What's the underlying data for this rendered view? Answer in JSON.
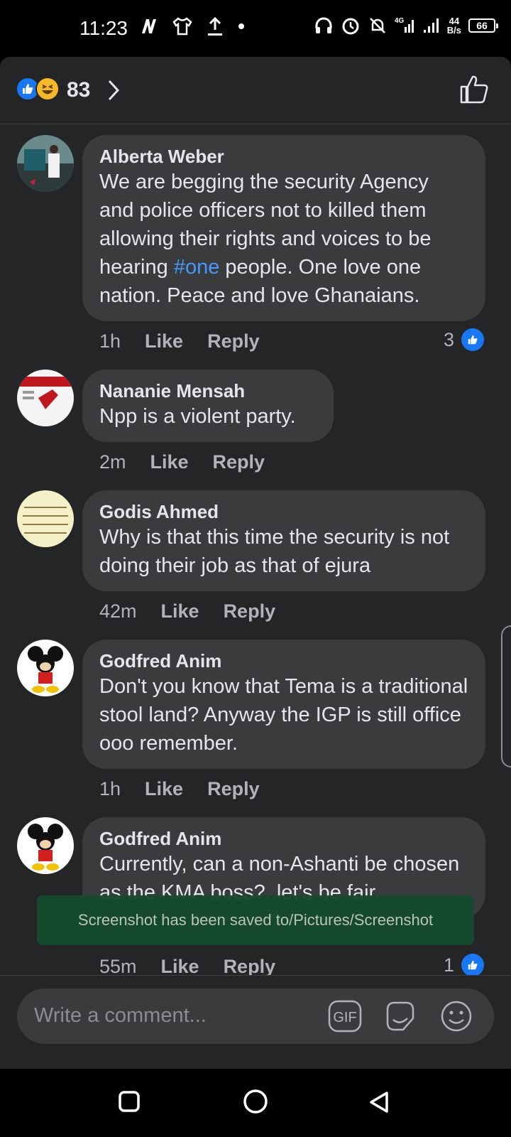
{
  "status_bar": {
    "time": "11:23",
    "network": "4G",
    "speed_value": "44",
    "speed_unit": "B/s",
    "battery": "66"
  },
  "reactions": {
    "count": "83"
  },
  "comments": [
    {
      "name": "Alberta Weber",
      "text_before": "We are begging the security Agency and police officers not to killed them allowing their rights and voices to be hearing ",
      "hashtag": "#one",
      "text_after": " people. One love  one nation.  Peace and love Ghanaians.",
      "time": "1h",
      "like_label": "Like",
      "reply_label": "Reply",
      "like_count": "3"
    },
    {
      "name": "Nananie Mensah",
      "text": "Npp is a violent party.",
      "time": "2m",
      "like_label": "Like",
      "reply_label": "Reply"
    },
    {
      "name": "Godis Ahmed",
      "text": "Why is that this time the security is not doing their job as that of ejura",
      "time": "42m",
      "like_label": "Like",
      "reply_label": "Reply"
    },
    {
      "name": "Godfred Anim",
      "text": "Don't you know that Tema is a traditional stool land? Anyway the IGP is still office ooo remember.",
      "time": "1h",
      "like_label": "Like",
      "reply_label": "Reply"
    },
    {
      "name": "Godfred Anim",
      "text": "Currently, can a non-Ashanti be chosen as the KMA boss?..let's be fair.",
      "time": "55m",
      "like_label": "Like",
      "reply_label": "Reply",
      "like_count": "1"
    }
  ],
  "toast": "Screenshot has been saved to/Pictures/Screenshot",
  "composer": {
    "placeholder": "Write a comment...",
    "gif_label": "GIF"
  },
  "colors": {
    "accent": "#1877f2",
    "bubble": "#3a3b3c",
    "sheet": "#242526",
    "hashtag": "#4599ff"
  }
}
